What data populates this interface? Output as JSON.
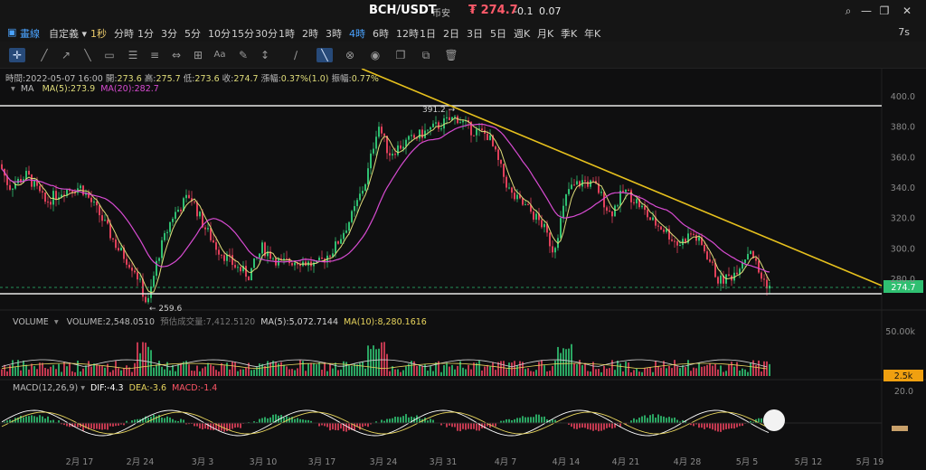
{
  "title": {
    "pair": "BCH/USDT",
    "exchange": "币安",
    "price": "₮ 274.7",
    "change": "-0.1",
    "change_pct": "0.07"
  },
  "timeframes": [
    "自定義",
    "1秒",
    "分時",
    "1分",
    "3分",
    "5分",
    "10分",
    "15分",
    "30分",
    "1時",
    "2時",
    "3時",
    "4時",
    "6時",
    "12時",
    "1日",
    "2日",
    "3日",
    "5日",
    "週K",
    "月K",
    "季K",
    "年K"
  ],
  "active_timeframe": "4時",
  "right_tf": "7s",
  "toolbar_icons": [
    "crosshair-icon",
    "line-icon",
    "ray-icon",
    "arrow-icon",
    "rect-icon",
    "parallel-icon",
    "fib-icon",
    "measure-icon",
    "text-icon",
    "brush-icon",
    "ruler-icon",
    "magnet-icon",
    "lock-icon",
    "eye-icon",
    "clone-icon",
    "layers-icon",
    "trash-icon"
  ],
  "info_line": {
    "time": "時間:2022-05-07 16:00",
    "open_label": "開:",
    "open": "273.6",
    "high_label": "高:",
    "high": "275.7",
    "low_label": "低:",
    "low": "273.6",
    "close_label": "收:",
    "close": "274.7",
    "chg_label": "漲幅:",
    "chg": "0.37%(1.0)",
    "amp_label": "振幅:",
    "amp": "0.77%"
  },
  "ma_legend": {
    "label": "MA",
    "ma5": "MA(5):273.9",
    "ma20": "MA(20):282.7"
  },
  "price_axis": [
    "400.0",
    "380.0",
    "360.0",
    "340.0",
    "320.0",
    "300.0",
    "280.0"
  ],
  "current_price_tag": "274.7",
  "annotations": {
    "high": "391.2",
    "low": "259.6"
  },
  "volume_legend": {
    "label": "VOLUME",
    "volume": "VOLUME:2,548.0510",
    "est": "預估成交量:7,412.5120",
    "ma5": "MA(5):5,072.7144",
    "ma10": "MA(10):8,280.1616"
  },
  "volume_axis": [
    "50.00k"
  ],
  "volume_tag": "2.5k",
  "macd_legend": {
    "label": "MACD(12,26,9)",
    "dif": "DIF:-4.3",
    "dea": "DEA:-3.6",
    "macd": "MACD:-1.4"
  },
  "macd_axis": [
    "20.0"
  ],
  "date_axis": [
    "2月 17",
    "2月 24",
    "3月 3",
    "3月 10",
    "3月 17",
    "3月 24",
    "3月 31",
    "4月 7",
    "4月 14",
    "4月 21",
    "4月 28",
    "5月 5",
    "5月 12",
    "5月 19"
  ],
  "colors": {
    "up": "#2fbf71",
    "down": "#e0405a",
    "ma5": "#e0dd7a",
    "ma20": "#d74bd1",
    "trend": "#e6c01d",
    "accent": "#4aa3ff"
  }
}
